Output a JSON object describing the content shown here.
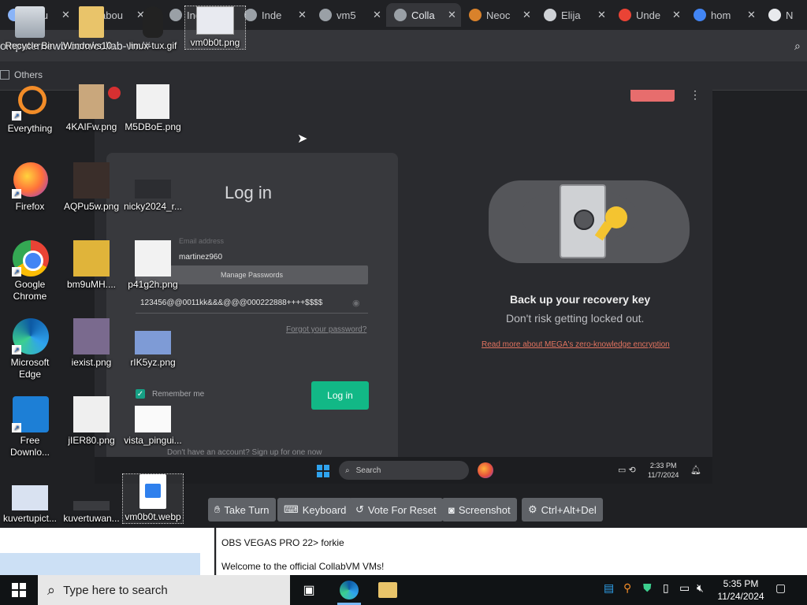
{
  "browser": {
    "tabs": [
      {
        "title": "abou",
        "icon": "globe"
      },
      {
        "title": "abou",
        "icon": "globe"
      },
      {
        "title": "Inde",
        "icon": "vm"
      },
      {
        "title": "Inde",
        "icon": "vm"
      },
      {
        "title": "vm5",
        "icon": "vm"
      },
      {
        "title": "Colla",
        "icon": "vm"
      },
      {
        "title": "Neoc",
        "icon": "cat"
      },
      {
        "title": "Elija",
        "icon": "globe"
      },
      {
        "title": "Unde",
        "icon": "google"
      },
      {
        "title": "hom",
        "icon": "globe"
      },
      {
        "title": "N",
        "icon": "globe"
      }
    ],
    "tab_close": "✕",
    "url": "omputernewb.com/collab-vm/#",
    "bookmark_others": "Others"
  },
  "vm_screen": {
    "login": {
      "heading": "Log in",
      "email_label": "Email address",
      "email_value": "martinez960",
      "manage_passwords": "Manage Passwords",
      "password_value": "123456@@0011kk&&&@@@000222888++++$$$$",
      "forgot": "Forgot your password?",
      "remember_me": "Remember me",
      "login_button": "Log in",
      "signup": "Don't have an account? Sign up for one now"
    },
    "promo": {
      "title": "Back up your recovery key",
      "subtitle": "Don't risk getting locked out.",
      "link": "Read more about MEGA's zero-knowledge encryption"
    },
    "taskbar": {
      "search": "Search",
      "time": "2:33 PM",
      "date": "11/7/2024"
    }
  },
  "controls": {
    "take_turn": "Take Turn",
    "keyboard": "Keyboard",
    "vote_reset": "Vote For Reset",
    "screenshot": "Screenshot",
    "ctrl_alt_del": "Ctrl+Alt+Del"
  },
  "chat": {
    "line1": "OBS VEGAS PRO 22> forkie",
    "line2": "Welcome to the official CollabVM VMs!"
  },
  "desktop_icons": [
    {
      "label": "Recycle Bin",
      "icon": "recycle-bin"
    },
    {
      "label": "Windows10...",
      "icon": "folder"
    },
    {
      "label": "linux-tux.gif",
      "icon": "tux"
    },
    {
      "label": "vm0b0t.png",
      "icon": "image"
    },
    {
      "label": "Everything",
      "icon": "everything"
    },
    {
      "label": "4KAIFw.png",
      "icon": "image"
    },
    {
      "label": "M5DBoE.png",
      "icon": "image"
    },
    {
      "label": "Firefox",
      "icon": "firefox"
    },
    {
      "label": "AQPu5w.png",
      "icon": "image"
    },
    {
      "label": "nicky2024_r...",
      "icon": "image"
    },
    {
      "label": "Google Chrome",
      "icon": "chrome"
    },
    {
      "label": "bm9uMH....",
      "icon": "image"
    },
    {
      "label": "p41g2h.png",
      "icon": "image"
    },
    {
      "label": "Microsoft Edge",
      "icon": "edge"
    },
    {
      "label": "iexist.png",
      "icon": "image"
    },
    {
      "label": "rIK5yz.png",
      "icon": "image"
    },
    {
      "label": "Free Downlo...",
      "icon": "fdm"
    },
    {
      "label": "jIER80.png",
      "icon": "image"
    },
    {
      "label": "vista_pingui...",
      "icon": "image"
    },
    {
      "label": "kuvertupict...",
      "icon": "image"
    },
    {
      "label": "kuvertuwan...",
      "icon": "image"
    },
    {
      "label": "vm0b0t.webp",
      "icon": "image"
    }
  ],
  "taskbar": {
    "search_placeholder": "Type here to search",
    "time": "5:35 PM",
    "date": "11/24/2024"
  },
  "colors": {
    "login_green": "#12b886",
    "mega_red": "#e76d6d",
    "accent_blue": "#2fa3ee"
  }
}
